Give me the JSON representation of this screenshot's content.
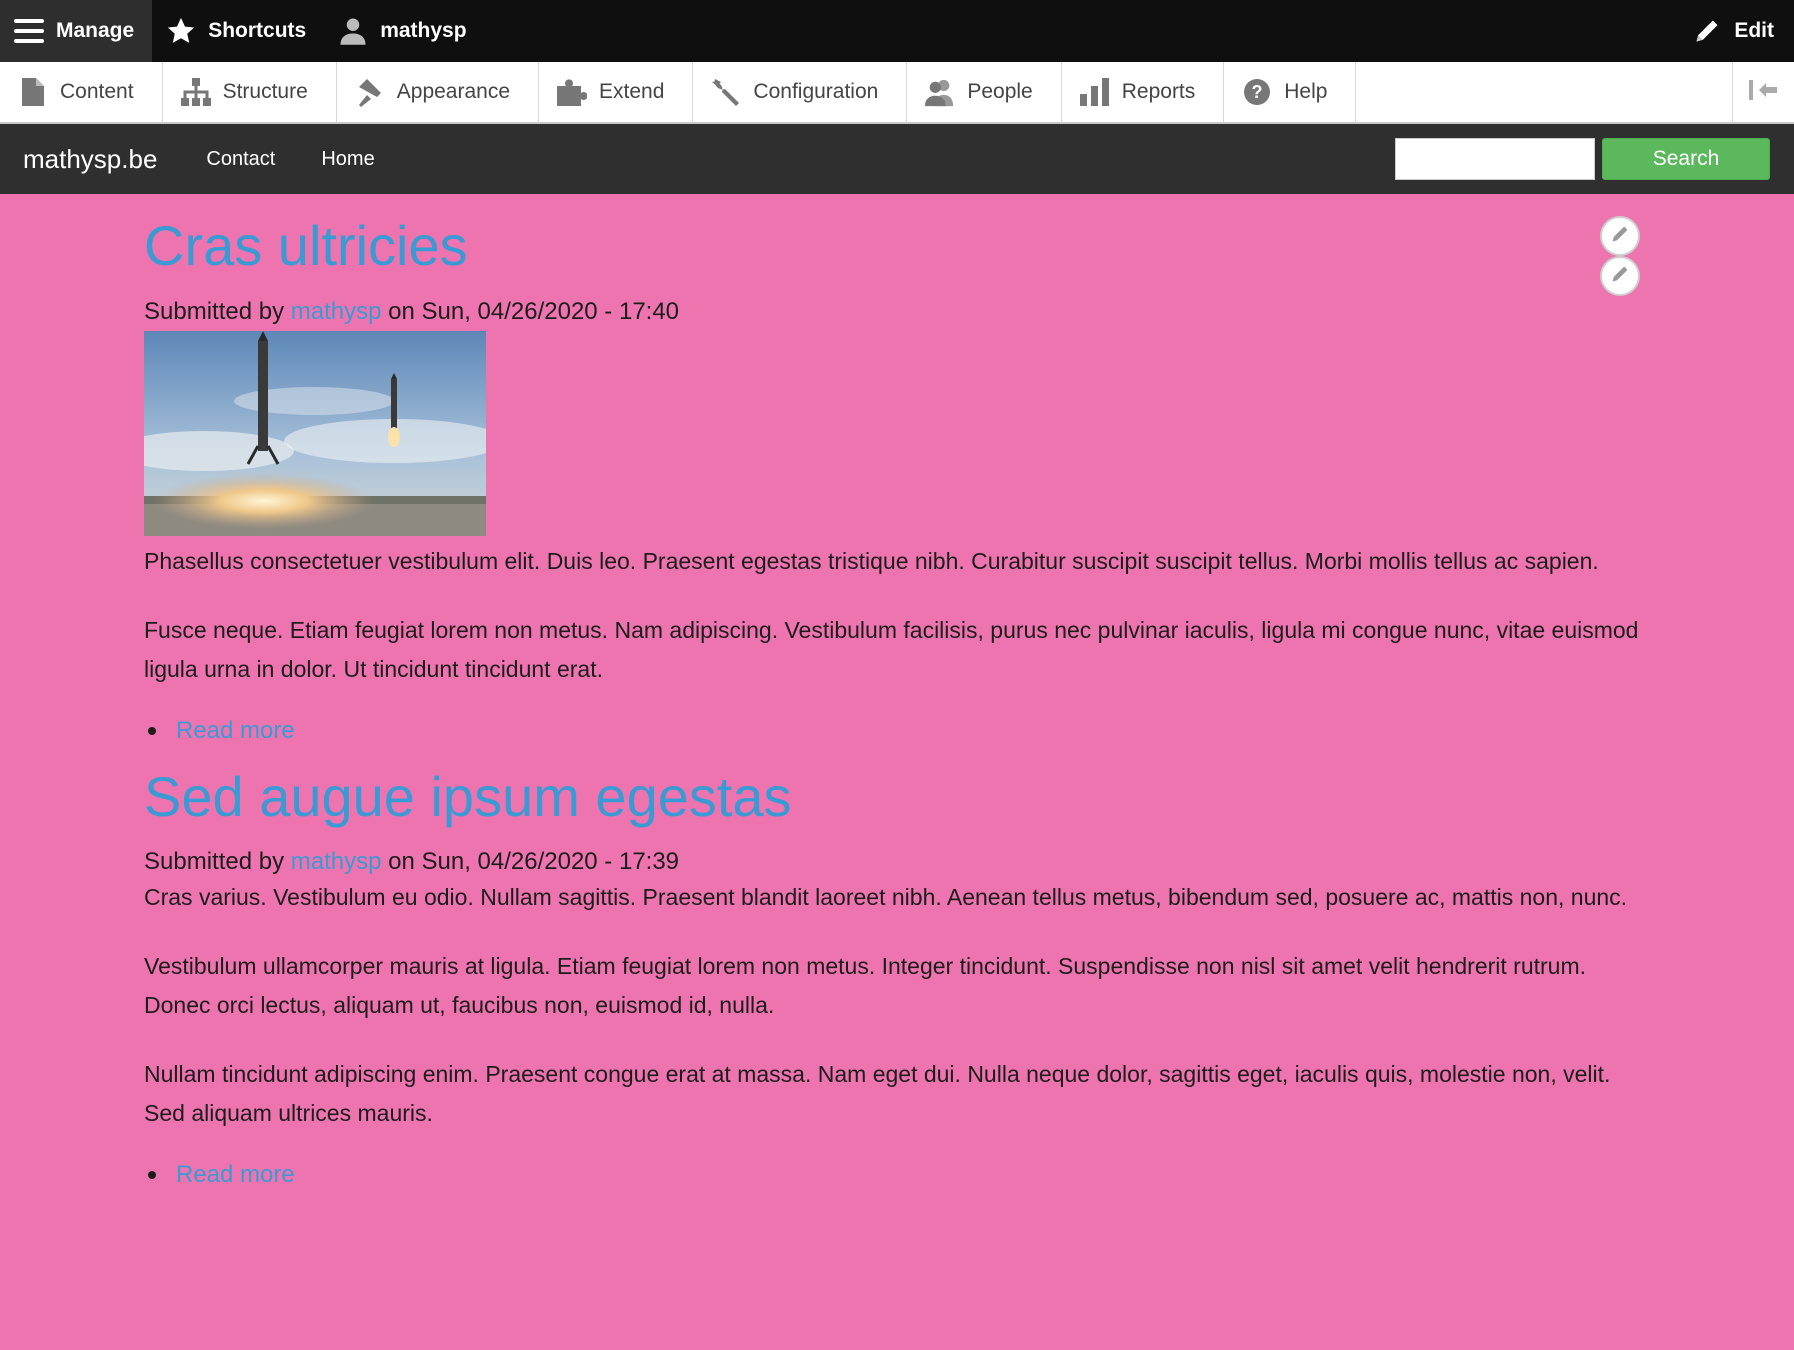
{
  "toolbar": {
    "manage": "Manage",
    "shortcuts": "Shortcuts",
    "user": "mathysp",
    "edit": "Edit"
  },
  "tray": {
    "items": [
      {
        "label": "Content",
        "icon": "file-icon"
      },
      {
        "label": "Structure",
        "icon": "sitemap-icon"
      },
      {
        "label": "Appearance",
        "icon": "paintbrush-icon"
      },
      {
        "label": "Extend",
        "icon": "puzzle-icon"
      },
      {
        "label": "Configuration",
        "icon": "wrench-icon"
      },
      {
        "label": "People",
        "icon": "people-icon"
      },
      {
        "label": "Reports",
        "icon": "bar-chart-icon"
      },
      {
        "label": "Help",
        "icon": "help-icon"
      }
    ]
  },
  "site": {
    "brand": "mathysp.be",
    "nav": [
      "Contact",
      "Home"
    ],
    "search_button": "Search",
    "search_value": ""
  },
  "articles": [
    {
      "title": "Cras ultricies",
      "submitted_prefix": "Submitted by ",
      "author": "mathysp",
      "submitted_suffix": " on Sun, 04/26/2020 - 17:40",
      "body": [
        "Phasellus consectetuer vestibulum elit. Duis leo. Praesent egestas tristique nibh. Curabitur suscipit suscipit tellus. Morbi mollis tellus ac sapien.",
        "Fusce neque. Etiam feugiat lorem non metus. Nam adipiscing. Vestibulum facilisis, purus nec pulvinar iaculis, ligula mi congue nunc, vitae euismod ligula urna in dolor. Ut tincidunt tincidunt erat."
      ],
      "read_more": "Read more"
    },
    {
      "title": "Sed augue ipsum egestas",
      "submitted_prefix": "Submitted by ",
      "author": "mathysp",
      "submitted_suffix": " on Sun, 04/26/2020 - 17:39",
      "body": [
        "Cras varius. Vestibulum eu odio. Nullam sagittis. Praesent blandit laoreet nibh. Aenean tellus metus, bibendum sed, posuere ac, mattis non, nunc.",
        "Vestibulum ullamcorper mauris at ligula. Etiam feugiat lorem non metus. Integer tincidunt. Suspendisse non nisl sit amet velit hendrerit rutrum. Donec orci lectus, aliquam ut, faucibus non, euismod id, nulla.",
        "Nullam tincidunt adipiscing enim. Praesent congue erat at massa. Nam eget dui. Nulla neque dolor, sagittis eget, iaculis quis, molestie non, velit. Sed aliquam ultrices mauris."
      ],
      "read_more": "Read more"
    }
  ],
  "colors": {
    "background": "#ee74b0",
    "link": "#3a9ad4",
    "toolbar": "#0f0f0f",
    "nav": "#2f2f2f",
    "search_button": "#5cb85c"
  }
}
